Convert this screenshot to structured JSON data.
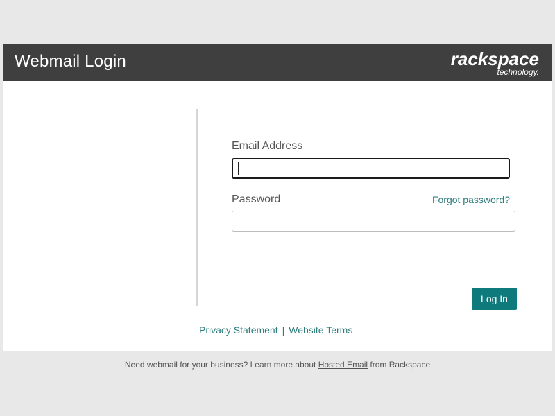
{
  "header": {
    "title": "Webmail Login",
    "logo_text": "rackspace",
    "logo_subtext": "technology."
  },
  "form": {
    "email_label": "Email Address",
    "email_value": "",
    "password_label": "Password",
    "password_value": "",
    "forgot_password": "Forgot password?",
    "login_button": "Log In"
  },
  "footer": {
    "privacy": "Privacy Statement",
    "separator": "|",
    "terms": "Website Terms"
  },
  "bottom_note": {
    "prefix": "Need webmail for your business? Learn more about",
    "link": "Hosted Email",
    "suffix": "from Rackspace"
  },
  "colors": {
    "header_bg": "#3f3f3f",
    "accent": "#0e7a7c",
    "link": "#2e7d7d",
    "page_bg": "#e8e8e8"
  }
}
